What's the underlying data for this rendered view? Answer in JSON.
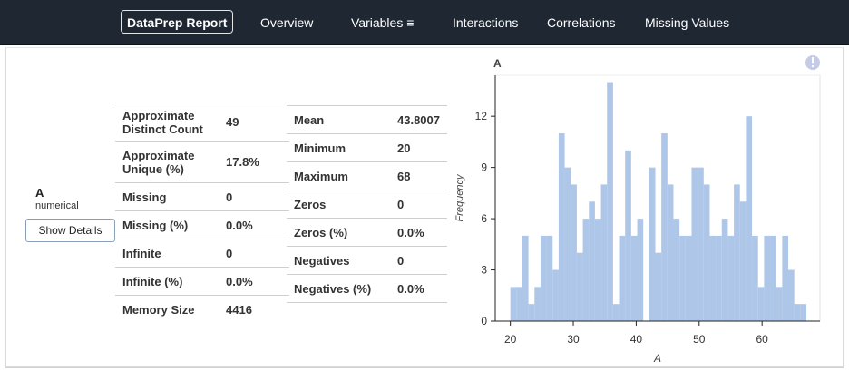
{
  "navbar": {
    "brand": "DataPrep Report",
    "items": [
      "Overview",
      "Variables ≡",
      "Interactions",
      "Correlations",
      "Missing Values"
    ]
  },
  "variable": {
    "name": "A",
    "type": "numerical",
    "show_details_label": "Show Details"
  },
  "stats_left": [
    {
      "label": "Approximate Distinct Count",
      "value": "49"
    },
    {
      "label": "Approximate Unique (%)",
      "value": "17.8%"
    },
    {
      "label": "Missing",
      "value": "0"
    },
    {
      "label": "Missing (%)",
      "value": "0.0%"
    },
    {
      "label": "Infinite",
      "value": "0"
    },
    {
      "label": "Infinite (%)",
      "value": "0.0%"
    },
    {
      "label": "Memory Size",
      "value": "4416"
    }
  ],
  "stats_right": [
    {
      "label": "Mean",
      "value": "43.8007"
    },
    {
      "label": "Minimum",
      "value": "20"
    },
    {
      "label": "Maximum",
      "value": "68"
    },
    {
      "label": "Zeros",
      "value": "0"
    },
    {
      "label": "Zeros (%)",
      "value": "0.0%"
    },
    {
      "label": "Negatives",
      "value": "0"
    },
    {
      "label": "Negatives (%)",
      "value": "0.0%"
    }
  ],
  "colors": {
    "navbar": "#1f2733",
    "bar": "#aec6e8",
    "info_icon": "#c5cbe6"
  },
  "info_icon": "info-icon",
  "chart_data": {
    "type": "bar",
    "title": "A",
    "xlabel": "A",
    "ylabel": "Frequency",
    "xlim": [
      17.6,
      69.2
    ],
    "ylim": [
      0,
      14.4
    ],
    "xticks": [
      20,
      30,
      40,
      50,
      60
    ],
    "yticks": [
      0,
      3,
      6,
      9,
      12
    ],
    "bin_start": 20,
    "bin_width": 0.96,
    "values": [
      2,
      2,
      5,
      1,
      2,
      5,
      5,
      3,
      11,
      9,
      8,
      4,
      6,
      7,
      6,
      8,
      14,
      1,
      5,
      10,
      5,
      6,
      0,
      9,
      4,
      11,
      8,
      6,
      5,
      5,
      9,
      9,
      8,
      5,
      5,
      6,
      5,
      8,
      7,
      12,
      5,
      2,
      5,
      5,
      2,
      5,
      3,
      1,
      1
    ]
  }
}
